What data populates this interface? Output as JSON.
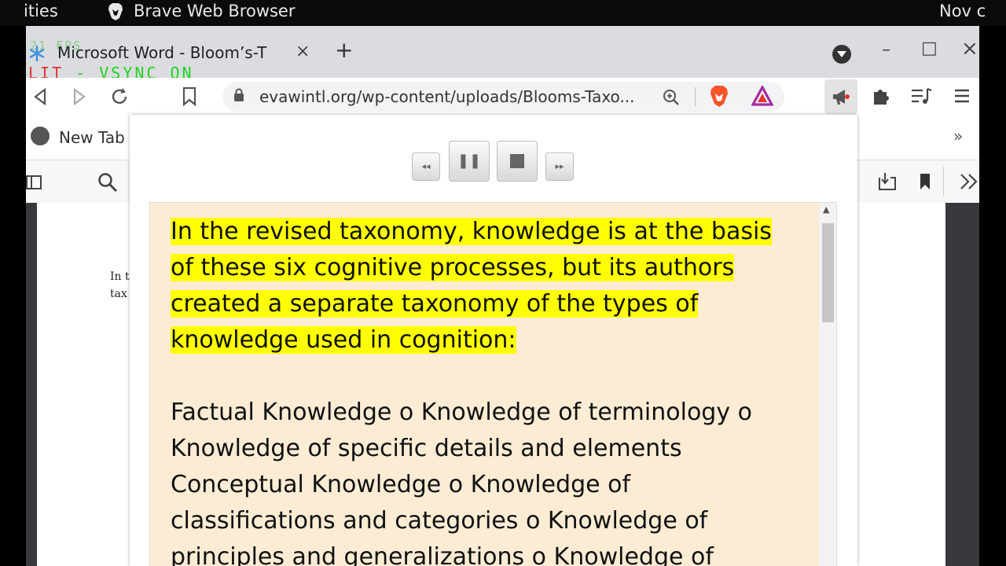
{
  "system_bar": {
    "activities": "ities",
    "app_name": "Brave Web Browser",
    "clock": "Nov c"
  },
  "tab": {
    "title": "Microsoft Word - Bloom’s-T",
    "close": "×",
    "new_tab": "+"
  },
  "overlay": {
    "fps": "21 FPS",
    "vsync_split": "LIT",
    "vsync_label": " - VSYNC ON"
  },
  "window_controls": {
    "minimize": "–",
    "maximize": "□",
    "close": "×"
  },
  "omnibox": {
    "url": "evawintl.org/wp-content/uploads/Blooms-Taxo..."
  },
  "bookmarks": {
    "item": "New Tab",
    "overflow": "»"
  },
  "pdf": {
    "line1": "In t",
    "line2": "tax"
  },
  "player": {
    "rewind": "◂◂",
    "pause": "❚❚",
    "forward": "▸▸"
  },
  "reader": {
    "highlighted": "In the revised taxonomy, knowledge is at the basis of these six cognitive processes, but its authors created a separate taxonomy of the types of knowledge used in cognition:",
    "body": " Factual Knowledge o Knowledge of terminology o Knowledge of specific details and elements  Conceptual Knowledge o Knowledge of classifications and categories o Knowledge of principles and generalizations o Knowledge of"
  },
  "colors": {
    "highlight": "#ffff00",
    "reader_bg": "#fcecd4",
    "brave_orange": "#fb542b"
  }
}
